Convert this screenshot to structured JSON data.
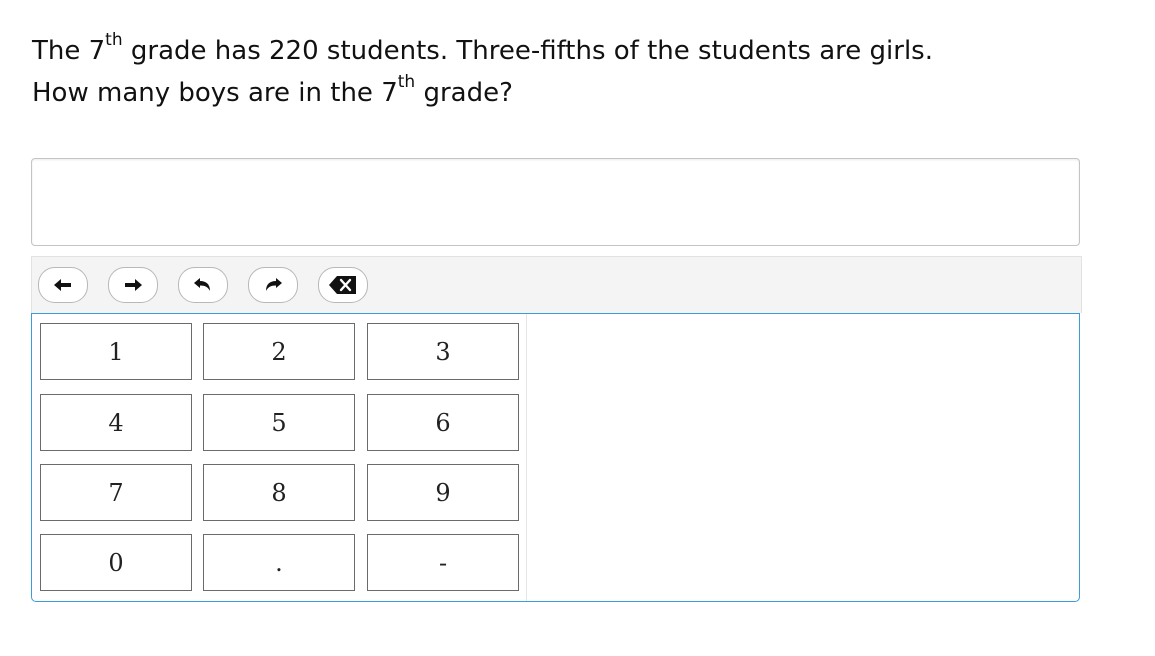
{
  "question": {
    "line1_a": "The 7",
    "line1_sup": "th",
    "line1_b": " grade has 220 students. Three-fifths of the students are girls.",
    "line2_a": "How many boys are in the 7",
    "line2_sup": "th",
    "line2_b": " grade?"
  },
  "answer": {
    "value": ""
  },
  "toolbar": {
    "buttons": [
      {
        "name": "move-left",
        "icon": "arrow-left-icon"
      },
      {
        "name": "move-right",
        "icon": "arrow-right-icon"
      },
      {
        "name": "undo",
        "icon": "undo-icon"
      },
      {
        "name": "redo",
        "icon": "redo-icon"
      },
      {
        "name": "backspace",
        "icon": "backspace-icon"
      }
    ]
  },
  "keypad": {
    "keys": [
      "1",
      "2",
      "3",
      "4",
      "5",
      "6",
      "7",
      "8",
      "9",
      "0",
      ".",
      "-"
    ]
  },
  "colors": {
    "keypad_border": "#3d9cd8",
    "toolbar_bg": "#f4f4f4",
    "key_border": "#6b6b6b"
  }
}
